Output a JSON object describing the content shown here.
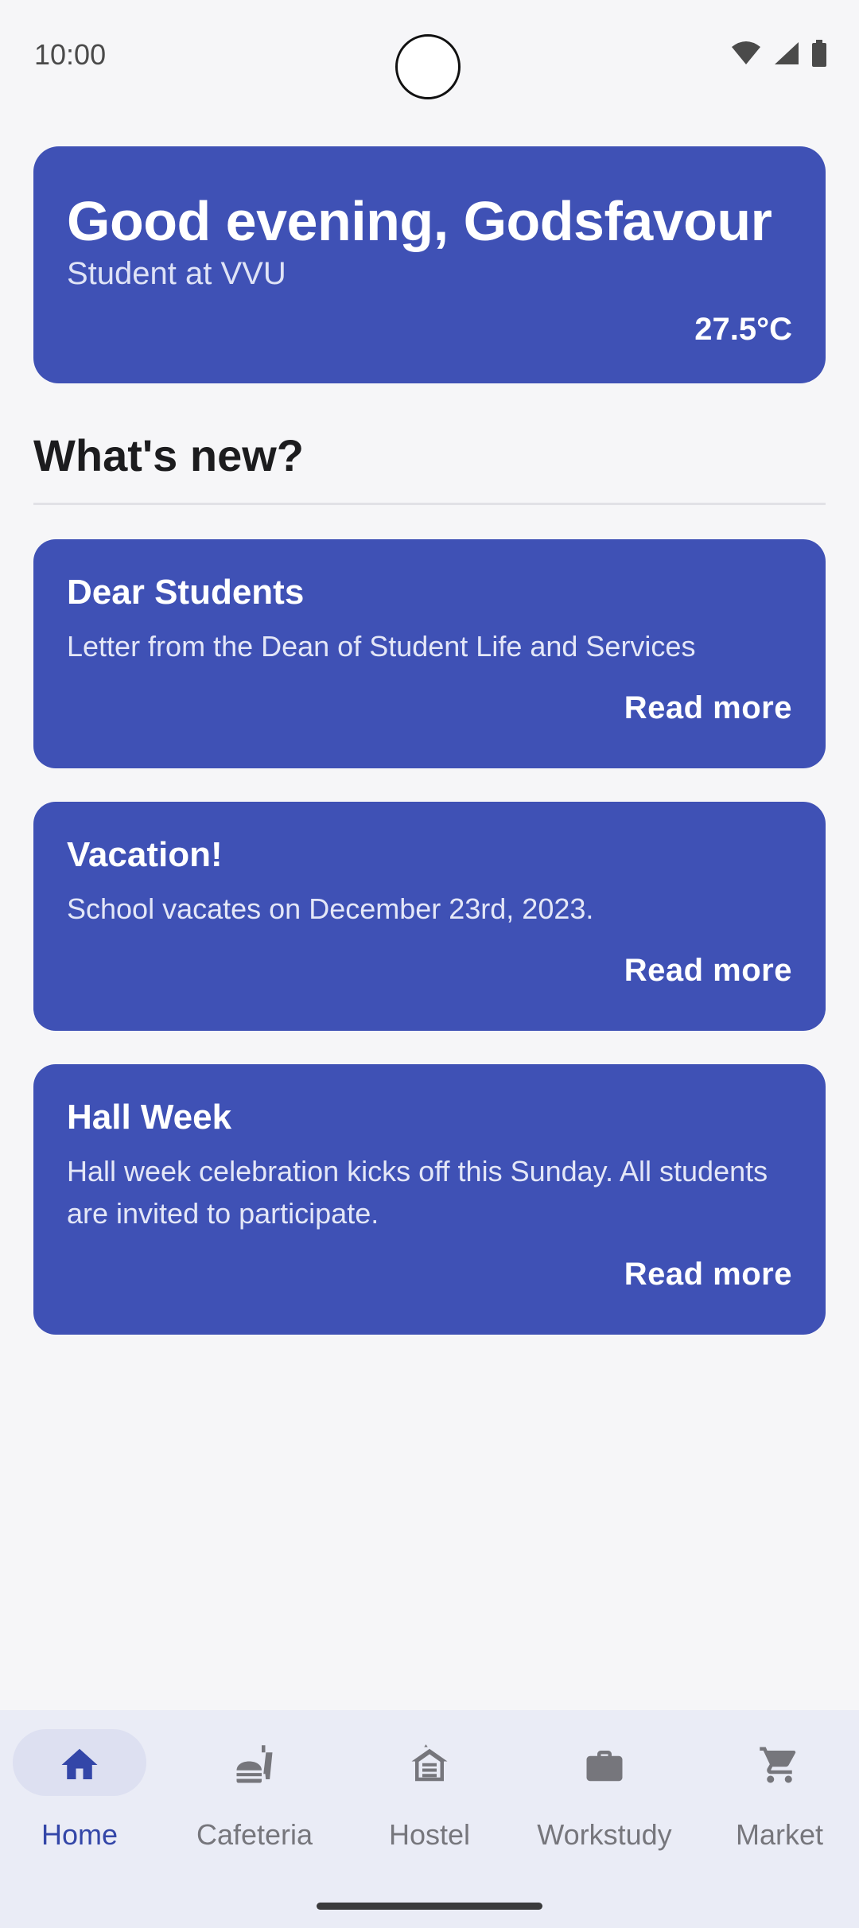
{
  "status_bar": {
    "time": "10:00"
  },
  "greeting": {
    "title": "Good evening, Godsfavour",
    "subtitle": "Student at VVU",
    "temperature": "27.5°C"
  },
  "section": {
    "title": "What's new?"
  },
  "news": [
    {
      "title": "Dear Students",
      "body": "Letter from the Dean of Student Life and Services",
      "action": "Read more"
    },
    {
      "title": "Vacation!",
      "body": "School vacates on December 23rd, 2023.",
      "action": "Read more"
    },
    {
      "title": "Hall Week",
      "body": "Hall week celebration kicks off this Sunday. All students are invited to participate.",
      "action": "Read more"
    }
  ],
  "nav": {
    "items": [
      {
        "label": "Home",
        "icon": "home-icon",
        "active": true
      },
      {
        "label": "Cafeteria",
        "icon": "fastfood-icon",
        "active": false
      },
      {
        "label": "Hostel",
        "icon": "hostel-icon",
        "active": false
      },
      {
        "label": "Workstudy",
        "icon": "briefcase-icon",
        "active": false
      },
      {
        "label": "Market",
        "icon": "cart-icon",
        "active": false
      }
    ]
  },
  "colors": {
    "primary": "#3f51b5",
    "background": "#f6f6f8",
    "nav_bg": "#eaecf6",
    "nav_active": "#3346a8"
  }
}
